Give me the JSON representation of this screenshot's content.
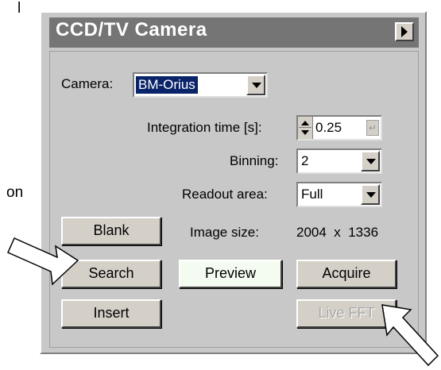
{
  "stray": {
    "top_right": "l",
    "mid_left": "on"
  },
  "panel": {
    "title": "CCD/TV Camera",
    "camera_label": "Camera:",
    "camera_value": "BM-Orius",
    "integration_label": "Integration time [s]:",
    "integration_value": "0.25",
    "binning_label": "Binning:",
    "binning_value": "2",
    "readout_label": "Readout area:",
    "readout_value": "Full",
    "image_size_label": "Image size:",
    "image_size_value": "2004  x  1336",
    "buttons": {
      "blank": "Blank",
      "search": "Search",
      "preview": "Preview",
      "acquire": "Acquire",
      "insert": "Insert",
      "live_fft": "Live FFT"
    }
  },
  "colors": {
    "title_bar": "#757575",
    "panel_bg": "#c8c8c8",
    "selection": "#0a246a",
    "preview_bg": "#f4fbf0"
  },
  "icons": [
    "expand-right-icon",
    "dropdown-arrow-icon",
    "spin-arrows-icon",
    "enter-icon",
    "callout-arrow-icon"
  ]
}
